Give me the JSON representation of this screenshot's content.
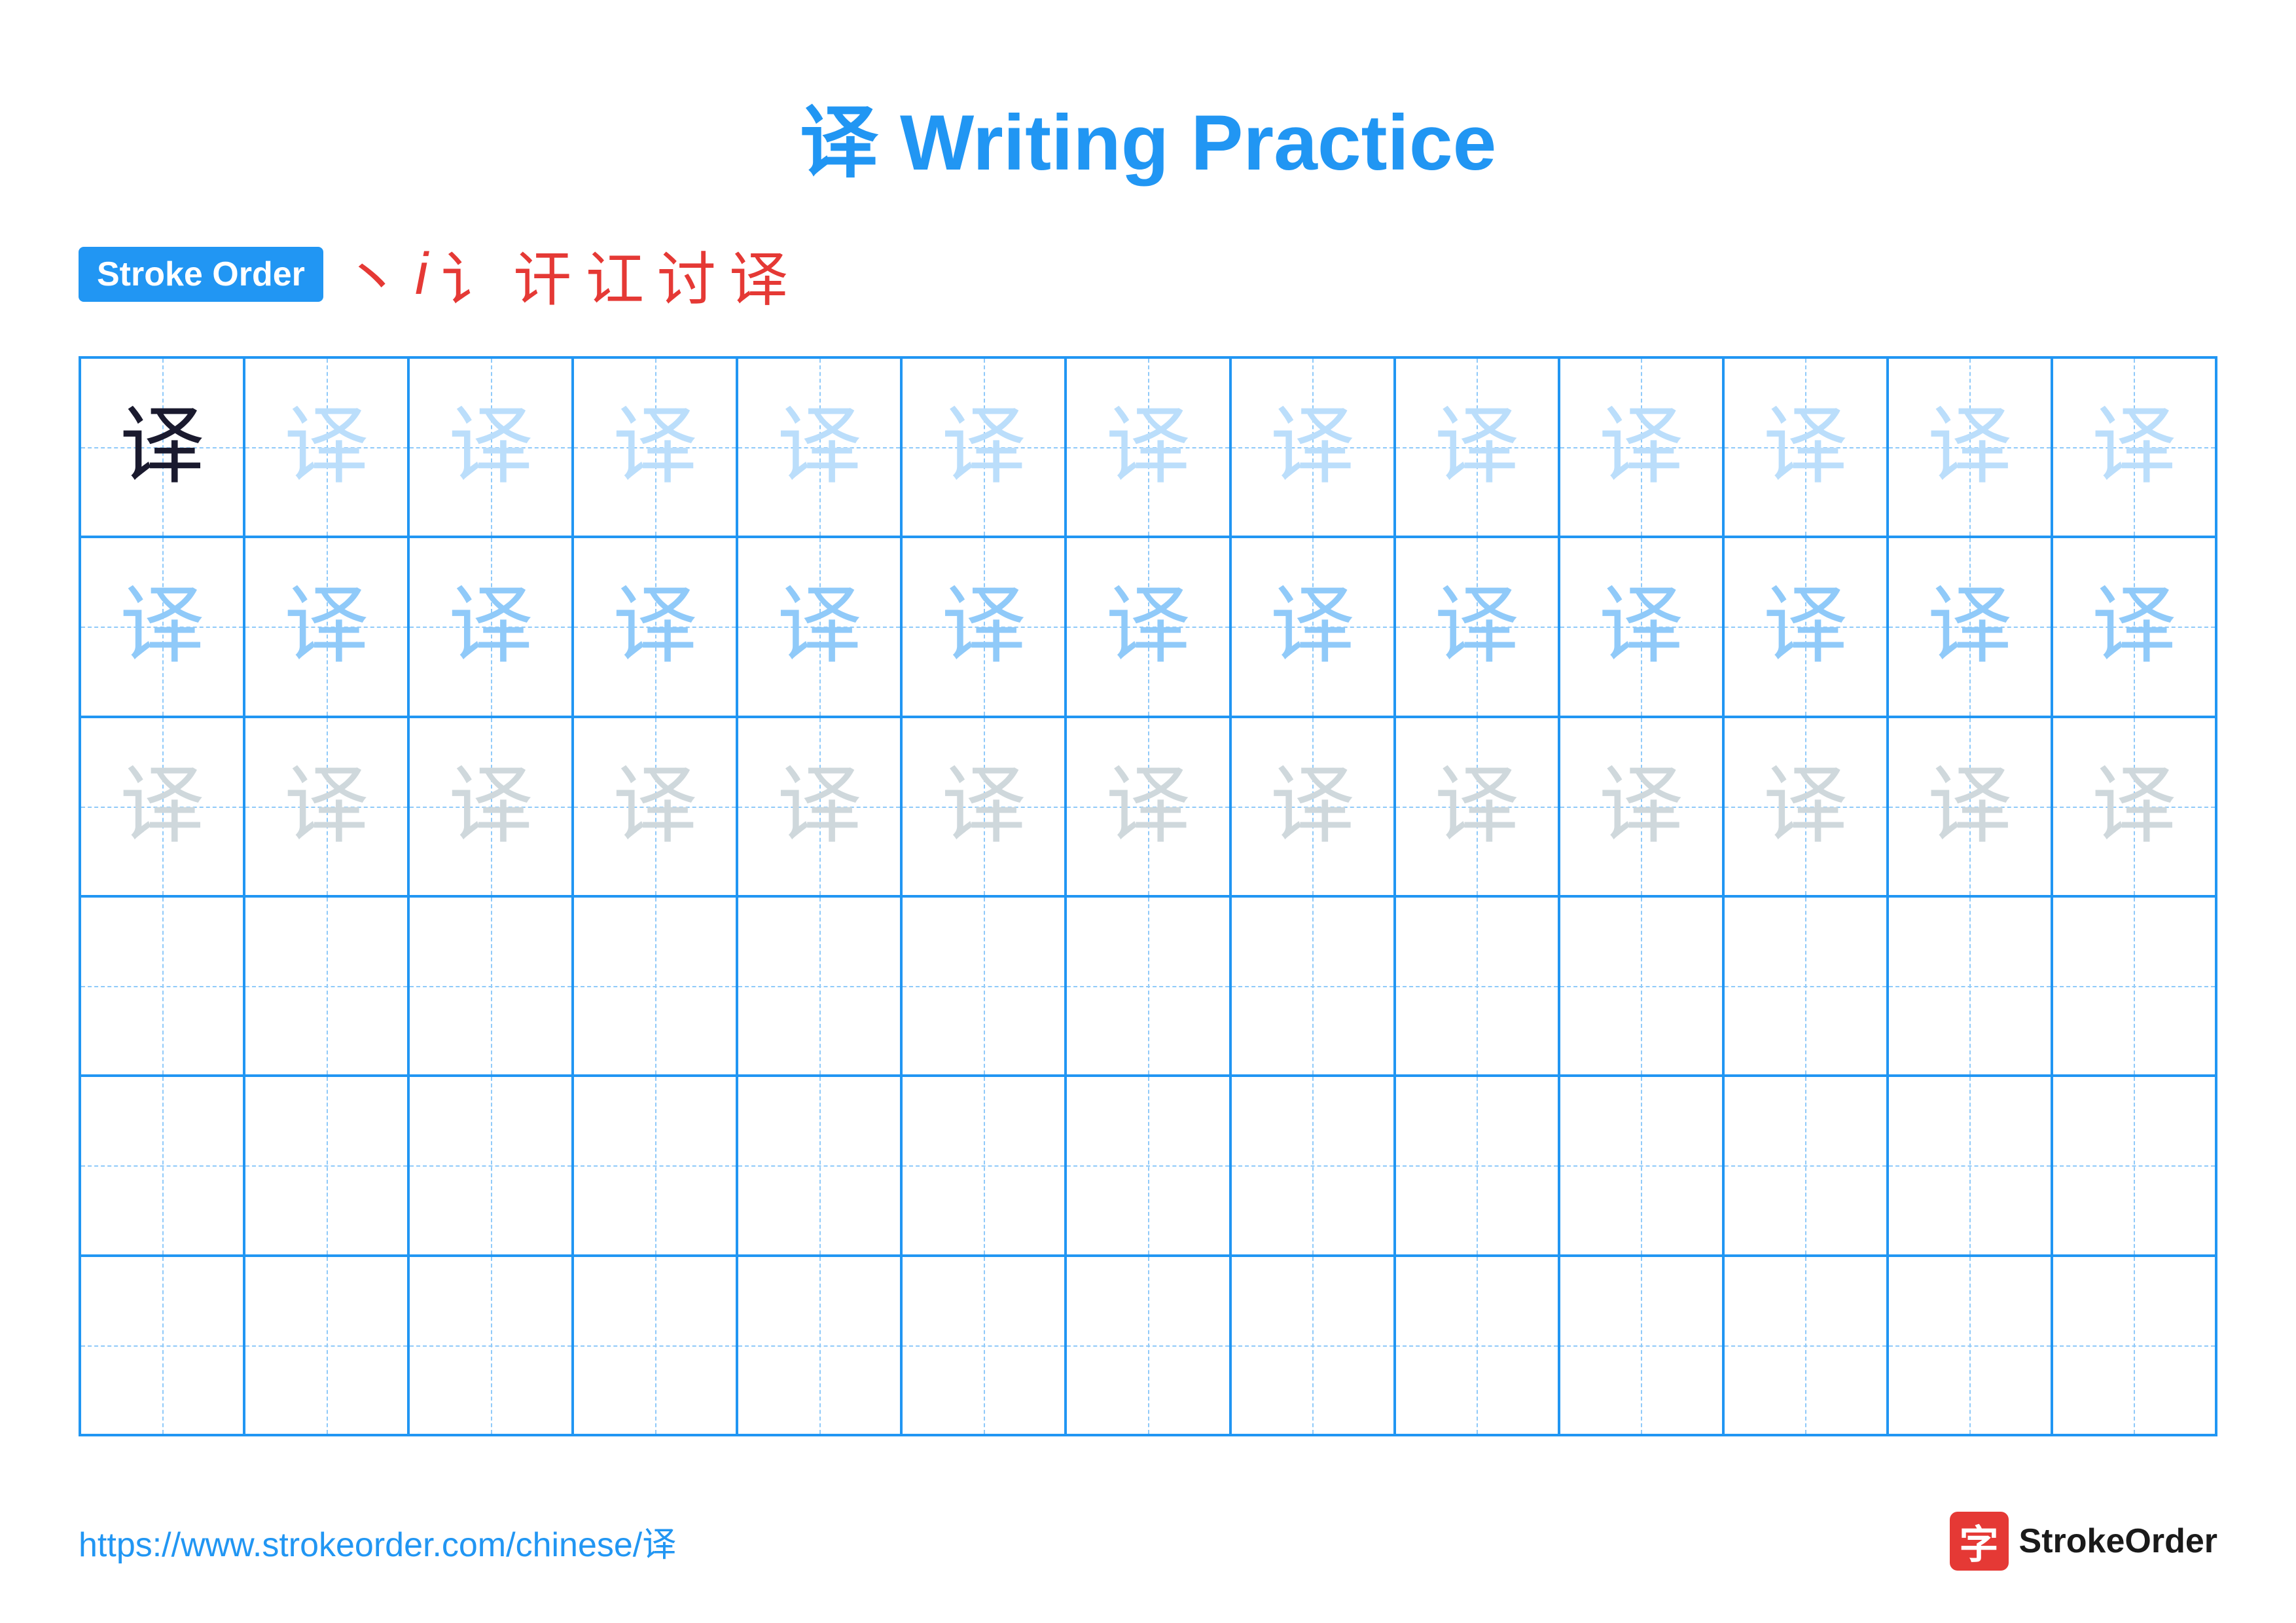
{
  "title": {
    "text": "译 Writing Practice"
  },
  "stroke_order": {
    "badge_label": "Stroke Order",
    "strokes": [
      "丶",
      "i",
      "讠",
      "讦",
      "讧",
      "讨",
      "译"
    ]
  },
  "grid": {
    "rows": 6,
    "cols": 13,
    "character": "译",
    "cells": [
      {
        "row": 0,
        "col": 0,
        "shade": "dark"
      },
      {
        "row": 0,
        "cols_light": true
      },
      {
        "row": 1,
        "shade": "medium"
      },
      {
        "row": 2,
        "shade": "light"
      }
    ]
  },
  "footer": {
    "url": "https://www.strokeorder.com/chinese/译",
    "logo_char": "字",
    "logo_text": "StrokeOrder"
  }
}
